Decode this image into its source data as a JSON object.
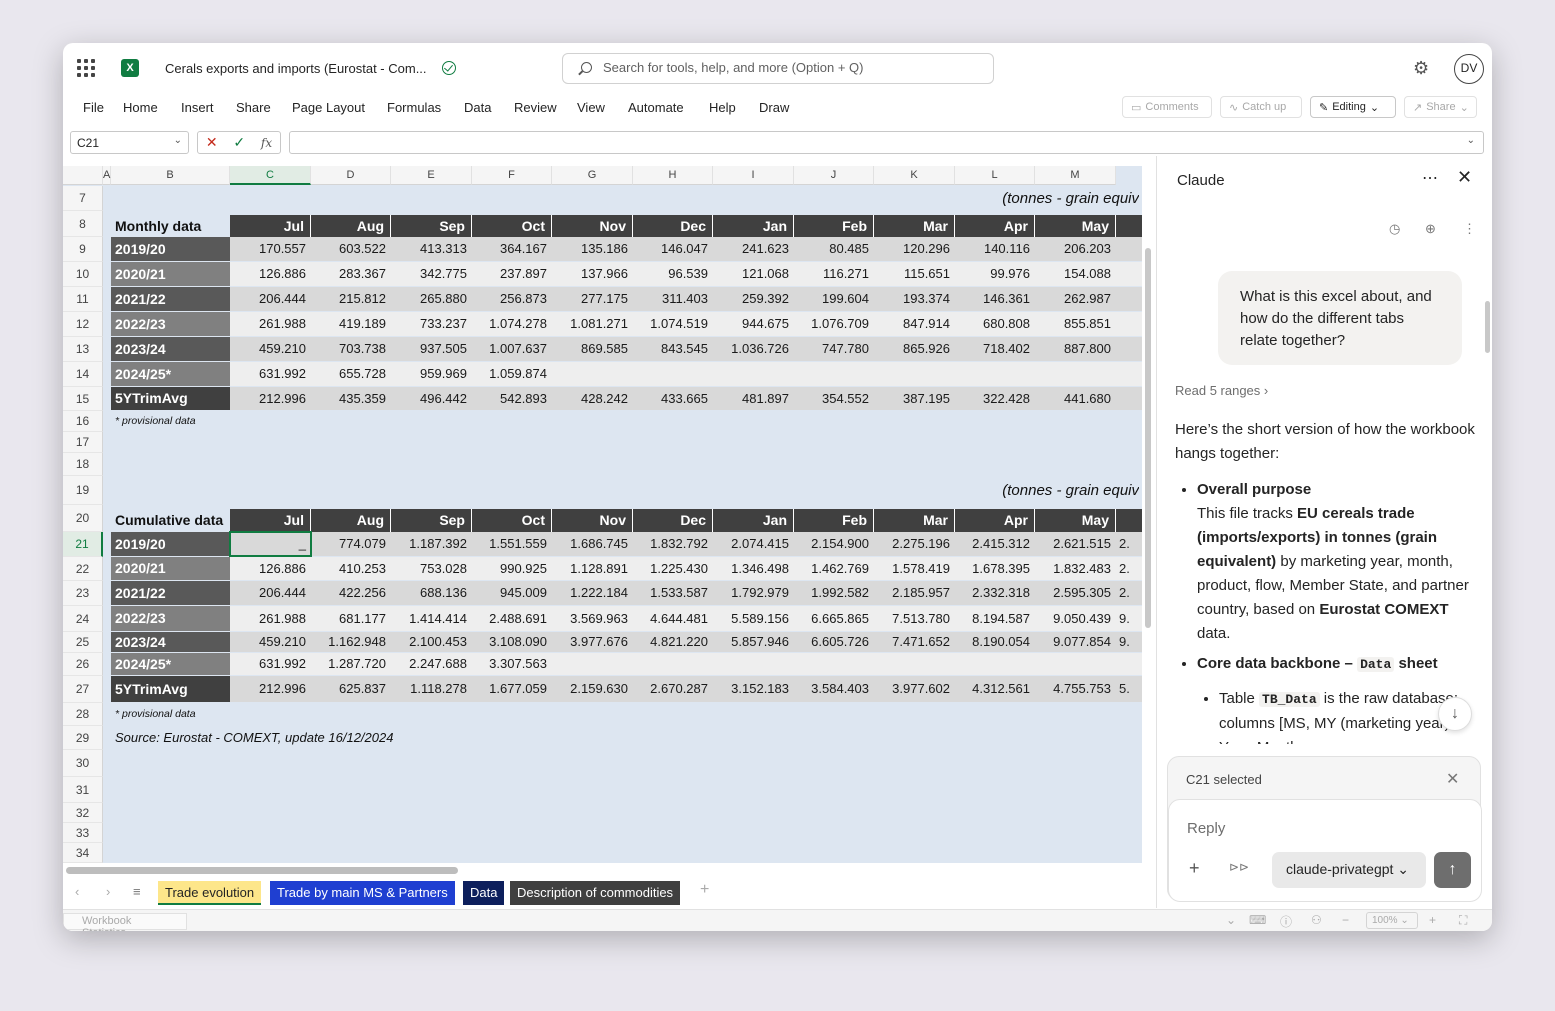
{
  "app": {
    "doc_title": "Cerals exports and imports (Eurostat - Com...",
    "search_placeholder": "Search for tools, help, and more (Option + Q)",
    "avatar_initials": "DV"
  },
  "menu": [
    "File",
    "Home",
    "Insert",
    "Share",
    "Page Layout",
    "Formulas",
    "Data",
    "Review",
    "View",
    "Automate",
    "Help",
    "Draw"
  ],
  "ribbon_buttons": {
    "comments": "Comments",
    "catch_up": "Catch up",
    "editing": "Editing",
    "share": "Share"
  },
  "formula_bar": {
    "name_box": "C21",
    "fx_label": "fx",
    "value": ""
  },
  "columns": [
    "A",
    "B",
    "C",
    "D",
    "E",
    "F",
    "G",
    "H",
    "I",
    "J",
    "K",
    "L",
    "M"
  ],
  "row_numbers": [
    "7",
    "8",
    "9",
    "10",
    "11",
    "12",
    "13",
    "14",
    "15",
    "16",
    "17",
    "18",
    "19",
    "20",
    "21",
    "22",
    "23",
    "24",
    "25",
    "26",
    "27",
    "28",
    "29",
    "30",
    "31",
    "32",
    "33",
    "34"
  ],
  "selected_cell": "C21",
  "monthly": {
    "unit_label": "(tonnes - grain equiv",
    "title": "Monthly data",
    "months": [
      "Jul",
      "Aug",
      "Sep",
      "Oct",
      "Nov",
      "Dec",
      "Jan",
      "Feb",
      "Mar",
      "Apr",
      "May"
    ],
    "rows": [
      {
        "label": "2019/20",
        "values": [
          "170.557",
          "603.522",
          "413.313",
          "364.167",
          "135.186",
          "146.047",
          "241.623",
          "80.485",
          "120.296",
          "140.116",
          "206.203"
        ]
      },
      {
        "label": "2020/21",
        "values": [
          "126.886",
          "283.367",
          "342.775",
          "237.897",
          "137.966",
          "96.539",
          "121.068",
          "116.271",
          "115.651",
          "99.976",
          "154.088"
        ]
      },
      {
        "label": "2021/22",
        "values": [
          "206.444",
          "215.812",
          "265.880",
          "256.873",
          "277.175",
          "311.403",
          "259.392",
          "199.604",
          "193.374",
          "146.361",
          "262.987"
        ]
      },
      {
        "label": "2022/23",
        "values": [
          "261.988",
          "419.189",
          "733.237",
          "1.074.278",
          "1.081.271",
          "1.074.519",
          "944.675",
          "1.076.709",
          "847.914",
          "680.808",
          "855.851"
        ]
      },
      {
        "label": "2023/24",
        "values": [
          "459.210",
          "703.738",
          "937.505",
          "1.007.637",
          "869.585",
          "843.545",
          "1.036.726",
          "747.780",
          "865.926",
          "718.402",
          "887.800"
        ]
      },
      {
        "label": "2024/25*",
        "values": [
          "631.992",
          "655.728",
          "959.969",
          "1.059.874",
          "",
          "",
          "",
          "",
          "",
          "",
          ""
        ]
      },
      {
        "label": "5YTrimAvg",
        "values": [
          "212.996",
          "435.359",
          "496.442",
          "542.893",
          "428.242",
          "433.665",
          "481.897",
          "354.552",
          "387.195",
          "322.428",
          "441.680"
        ]
      }
    ],
    "note": "* provisional data"
  },
  "cumulative": {
    "unit_label": "(tonnes - grain equiv",
    "title": "Cumulative data",
    "months": [
      "Jul",
      "Aug",
      "Sep",
      "Oct",
      "Nov",
      "Dec",
      "Jan",
      "Feb",
      "Mar",
      "Apr",
      "May"
    ],
    "rows": [
      {
        "label": "2019/20",
        "values": [
          "_",
          "774.079",
          "1.187.392",
          "1.551.559",
          "1.686.745",
          "1.832.792",
          "2.074.415",
          "2.154.900",
          "2.275.196",
          "2.415.312",
          "2.621.515"
        ],
        "overflow": "2."
      },
      {
        "label": "2020/21",
        "values": [
          "126.886",
          "410.253",
          "753.028",
          "990.925",
          "1.128.891",
          "1.225.430",
          "1.346.498",
          "1.462.769",
          "1.578.419",
          "1.678.395",
          "1.832.483"
        ],
        "overflow": "2."
      },
      {
        "label": "2021/22",
        "values": [
          "206.444",
          "422.256",
          "688.136",
          "945.009",
          "1.222.184",
          "1.533.587",
          "1.792.979",
          "1.992.582",
          "2.185.957",
          "2.332.318",
          "2.595.305"
        ],
        "overflow": "2."
      },
      {
        "label": "2022/23",
        "values": [
          "261.988",
          "681.177",
          "1.414.414",
          "2.488.691",
          "3.569.963",
          "4.644.481",
          "5.589.156",
          "6.665.865",
          "7.513.780",
          "8.194.587",
          "9.050.439"
        ],
        "overflow": "9."
      },
      {
        "label": "2023/24",
        "values": [
          "459.210",
          "1.162.948",
          "2.100.453",
          "3.108.090",
          "3.977.676",
          "4.821.220",
          "5.857.946",
          "6.605.726",
          "7.471.652",
          "8.190.054",
          "9.077.854"
        ],
        "overflow": "9."
      },
      {
        "label": "2024/25*",
        "values": [
          "631.992",
          "1.287.720",
          "2.247.688",
          "3.307.563",
          "",
          "",
          "",
          "",
          "",
          "",
          ""
        ],
        "overflow": ""
      },
      {
        "label": "5YTrimAvg",
        "values": [
          "212.996",
          "625.837",
          "1.118.278",
          "1.677.059",
          "2.159.630",
          "2.670.287",
          "3.152.183",
          "3.584.403",
          "3.977.602",
          "4.312.561",
          "4.755.753"
        ],
        "overflow": "5."
      }
    ],
    "note": "* provisional data",
    "source": "Source: Eurostat - COMEXT, update 16/12/2024"
  },
  "sheet_tabs": [
    {
      "label": "Trade evolution",
      "bg": "#fde68a",
      "fg": "#242424",
      "active": true
    },
    {
      "label": "Trade by main MS & Partners",
      "bg": "#1f3fd1",
      "fg": "#ffffff",
      "active": false
    },
    {
      "label": "Data",
      "bg": "#0d1f5c",
      "fg": "#ffffff",
      "active": false
    },
    {
      "label": "Description of commodities",
      "bg": "#404040",
      "fg": "#ffffff",
      "active": false
    }
  ],
  "status_bar": {
    "label": "Workbook Statistics",
    "zoom": "100%"
  },
  "panel": {
    "title": "Claude",
    "user_message": "What is this excel about, and how do the different tabs relate together?",
    "read_ranges": "Read 5 ranges",
    "reply_intro": "Here’s the short version of how the workbook hangs together:",
    "b1_title": "Overall purpose",
    "b1_t1": "This file tracks ",
    "b1_bold1": "EU cereals trade (imports/exports) in tonnes (grain equivalent)",
    "b1_t2": " by marketing year, month, product, flow, Member State, and partner country, based on ",
    "b1_bold2": "Eurostat COMEXT",
    "b1_t3": " data.",
    "b2_title": "Core data backbone – ",
    "b2_code": "Data",
    "b2_suffix": " sheet",
    "sub_t1": "Table ",
    "sub_code": "TB_Data",
    "sub_t2": " is the raw database: columns [MS, MY (marketing year), Year, Month",
    "context": "C21 selected",
    "reply_placeholder": "Reply",
    "model": "claude-privategpt"
  },
  "colors": {
    "excel_green": "#107c41",
    "header_dark": "#404040",
    "label_dark": "#595959",
    "label_mid": "#808080",
    "grid_bg": "#dde6f1"
  }
}
